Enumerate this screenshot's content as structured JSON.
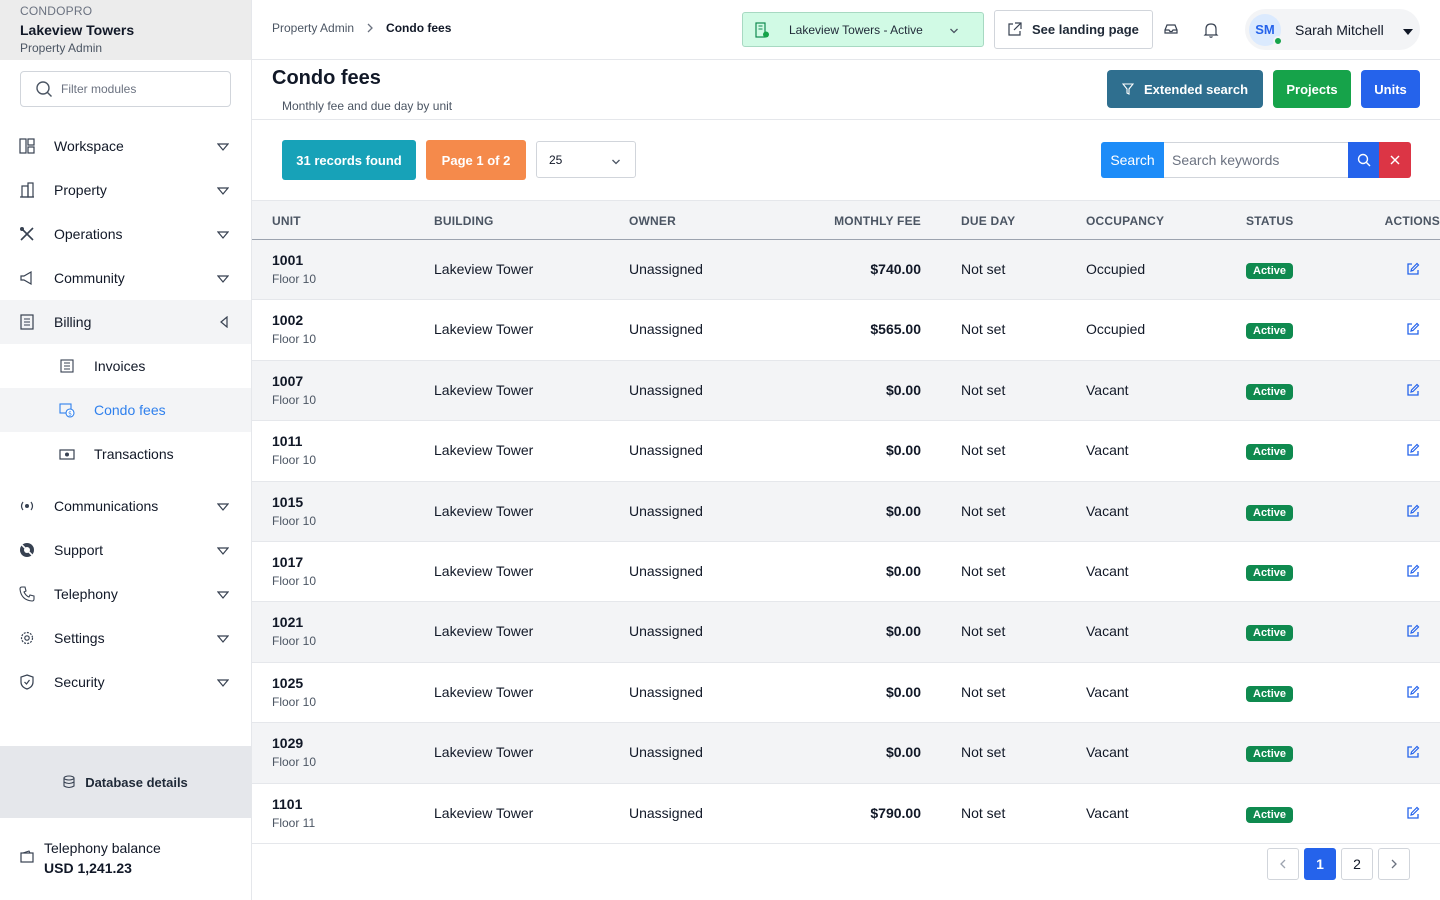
{
  "brand": {
    "org": "CONDOPRO",
    "name": "Lakeview Towers",
    "role": "Property Admin"
  },
  "sidebar": {
    "filter_placeholder": "Filter modules",
    "items": [
      {
        "label": "Workspace",
        "icon": "layout-icon"
      },
      {
        "label": "Property",
        "icon": "building-icon"
      },
      {
        "label": "Operations",
        "icon": "tools-icon"
      },
      {
        "label": "Community",
        "icon": "megaphone-icon"
      },
      {
        "label": "Billing",
        "icon": "receipt-icon"
      }
    ],
    "billing_sub": [
      {
        "label": "Invoices",
        "icon": "invoice-icon"
      },
      {
        "label": "Condo fees",
        "icon": "condo-fees-icon"
      },
      {
        "label": "Transactions",
        "icon": "cash-icon"
      }
    ],
    "items_after": [
      {
        "label": "Communications",
        "icon": "broadcast-icon"
      },
      {
        "label": "Support",
        "icon": "lifebuoy-icon"
      },
      {
        "label": "Telephony",
        "icon": "phone-icon"
      },
      {
        "label": "Settings",
        "icon": "gear-icon"
      },
      {
        "label": "Security",
        "icon": "shield-icon"
      }
    ],
    "db_details": "Database details",
    "balance_label": "Telephony balance",
    "balance_value": "USD 1,241.23"
  },
  "header": {
    "crumb_root": "Property Admin",
    "crumb_current": "Condo fees",
    "property_select": "Lakeview Towers - Active",
    "landing_button": "See landing page",
    "user_initials": "SM",
    "user_name": "Sarah Mitchell"
  },
  "page": {
    "title": "Condo fees",
    "subtitle": "Monthly fee and due day by unit",
    "extended_search": "Extended search",
    "projects": "Projects",
    "units": "Units"
  },
  "toolbar": {
    "records": "31 records found",
    "page_info": "Page 1 of 2",
    "per_page": "25",
    "search_label": "Search",
    "search_placeholder": "Search keywords"
  },
  "table": {
    "columns": [
      "UNIT",
      "BUILDING",
      "OWNER",
      "MONTHLY FEE",
      "DUE DAY",
      "OCCUPANCY",
      "STATUS",
      "ACTIONS"
    ],
    "rows": [
      {
        "unit": "1001",
        "floor": "Floor 10",
        "building": "Lakeview Tower",
        "owner": "Unassigned",
        "fee": "$740.00",
        "due": "Not set",
        "occupancy": "Occupied",
        "status": "Active"
      },
      {
        "unit": "1002",
        "floor": "Floor 10",
        "building": "Lakeview Tower",
        "owner": "Unassigned",
        "fee": "$565.00",
        "due": "Not set",
        "occupancy": "Occupied",
        "status": "Active"
      },
      {
        "unit": "1007",
        "floor": "Floor 10",
        "building": "Lakeview Tower",
        "owner": "Unassigned",
        "fee": "$0.00",
        "due": "Not set",
        "occupancy": "Vacant",
        "status": "Active"
      },
      {
        "unit": "1011",
        "floor": "Floor 10",
        "building": "Lakeview Tower",
        "owner": "Unassigned",
        "fee": "$0.00",
        "due": "Not set",
        "occupancy": "Vacant",
        "status": "Active"
      },
      {
        "unit": "1015",
        "floor": "Floor 10",
        "building": "Lakeview Tower",
        "owner": "Unassigned",
        "fee": "$0.00",
        "due": "Not set",
        "occupancy": "Vacant",
        "status": "Active"
      },
      {
        "unit": "1017",
        "floor": "Floor 10",
        "building": "Lakeview Tower",
        "owner": "Unassigned",
        "fee": "$0.00",
        "due": "Not set",
        "occupancy": "Vacant",
        "status": "Active"
      },
      {
        "unit": "1021",
        "floor": "Floor 10",
        "building": "Lakeview Tower",
        "owner": "Unassigned",
        "fee": "$0.00",
        "due": "Not set",
        "occupancy": "Vacant",
        "status": "Active"
      },
      {
        "unit": "1025",
        "floor": "Floor 10",
        "building": "Lakeview Tower",
        "owner": "Unassigned",
        "fee": "$0.00",
        "due": "Not set",
        "occupancy": "Vacant",
        "status": "Active"
      },
      {
        "unit": "1029",
        "floor": "Floor 10",
        "building": "Lakeview Tower",
        "owner": "Unassigned",
        "fee": "$0.00",
        "due": "Not set",
        "occupancy": "Vacant",
        "status": "Active"
      },
      {
        "unit": "1101",
        "floor": "Floor 11",
        "building": "Lakeview Tower",
        "owner": "Unassigned",
        "fee": "$790.00",
        "due": "Not set",
        "occupancy": "Vacant",
        "status": "Active"
      }
    ]
  },
  "pagination": {
    "pages": [
      "1",
      "2"
    ],
    "current": "1"
  },
  "colors": {
    "primary": "#2563eb",
    "teal": "#17a2b8",
    "orange": "#f58a4b",
    "success": "#16a34a",
    "danger": "#dc3545",
    "active_badge": "#0f8a4f"
  }
}
